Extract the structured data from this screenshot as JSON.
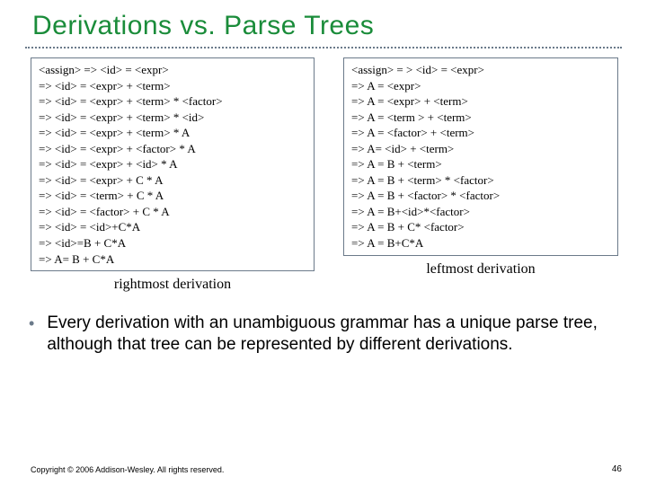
{
  "title": "Derivations vs. Parse Trees",
  "left": {
    "lines": [
      "<assign> => <id> = <expr>",
      "=> <id> = <expr> + <term>",
      "=> <id> = <expr> + <term> * <factor>",
      "=> <id> = <expr> + <term> * <id>",
      "=> <id> = <expr> + <term> * A",
      "=> <id> = <expr> + <factor> * A",
      "=> <id> = <expr> + <id> * A",
      "=> <id> = <expr> + C * A",
      "=> <id> = <term> + C * A",
      "=> <id> = <factor> + C * A",
      "=> <id> = <id>+C*A",
      "=> <id>=B + C*A",
      "=> A= B + C*A"
    ],
    "caption": "rightmost derivation"
  },
  "right": {
    "lines": [
      "<assign> = > <id> = <expr>",
      "=> A = <expr>",
      "=> A = <expr> + <term>",
      "=> A = <term > + <term>",
      "=> A = <factor> + <term>",
      "=> A= <id> + <term>",
      "=> A = B + <term>",
      "=> A = B + <term> * <factor>",
      "=> A = B + <factor> * <factor>",
      "=> A = B+<id>*<factor>",
      "=> A = B + C* <factor>",
      "=> A = B+C*A"
    ],
    "caption": "leftmost derivation"
  },
  "bullet": "Every derivation with an unambiguous grammar has a unique parse tree, although that tree can be represented by different derivations.",
  "copyright": "Copyright © 2006 Addison-Wesley. All rights reserved.",
  "page": "46"
}
